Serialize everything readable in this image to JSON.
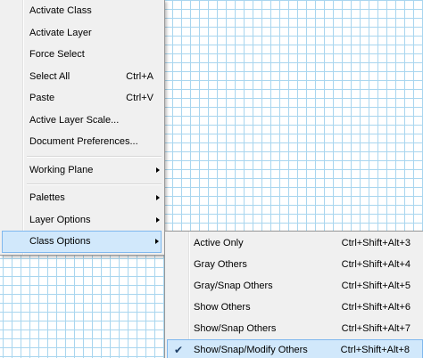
{
  "main_menu": {
    "group1": [
      {
        "label": "Activate Class",
        "shortcut": ""
      },
      {
        "label": "Activate Layer",
        "shortcut": ""
      },
      {
        "label": "Force Select",
        "shortcut": ""
      },
      {
        "label": "Select All",
        "shortcut": "Ctrl+A"
      },
      {
        "label": "Paste",
        "shortcut": "Ctrl+V"
      },
      {
        "label": "Active Layer Scale...",
        "shortcut": ""
      },
      {
        "label": "Document Preferences...",
        "shortcut": ""
      }
    ],
    "group2": [
      {
        "label": "Working Plane",
        "has_submenu": true
      }
    ],
    "group3": [
      {
        "label": "Palettes",
        "has_submenu": true
      },
      {
        "label": "Layer Options",
        "has_submenu": true
      },
      {
        "label": "Class Options",
        "has_submenu": true,
        "highlighted": true
      }
    ]
  },
  "class_options_submenu": {
    "items": [
      {
        "label": "Active Only",
        "shortcut": "Ctrl+Shift+Alt+3"
      },
      {
        "label": "Gray Others",
        "shortcut": "Ctrl+Shift+Alt+4"
      },
      {
        "label": "Gray/Snap Others",
        "shortcut": "Ctrl+Shift+Alt+5"
      },
      {
        "label": "Show Others",
        "shortcut": "Ctrl+Shift+Alt+6"
      },
      {
        "label": "Show/Snap Others",
        "shortcut": "Ctrl+Shift+Alt+7"
      },
      {
        "label": "Show/Snap/Modify Others",
        "shortcut": "Ctrl+Shift+Alt+8",
        "checked": true,
        "highlighted": true
      }
    ],
    "check_icon": "check-icon"
  },
  "colors": {
    "menu_background": "#f0f0f0",
    "highlight_background": "#d1e8fb",
    "highlight_border": "#7fb8ee",
    "grid_line": "#a9d6ef"
  }
}
